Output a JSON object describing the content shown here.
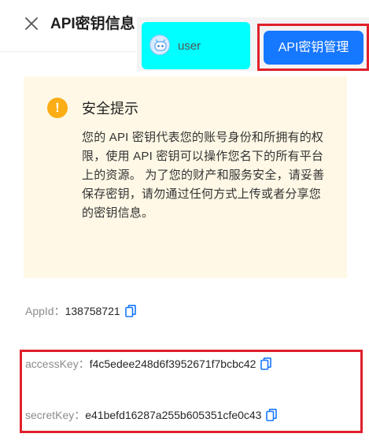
{
  "header": {
    "title": "API密钥信息"
  },
  "user": {
    "name": "user"
  },
  "toolbar": {
    "manage_label": "API密钥管理"
  },
  "notice": {
    "title": "安全提示",
    "body": "您的 API 密钥代表您的账号身份和所拥有的权限，使用 API 密钥可以操作您名下的所有平台上的资源。 为了您的财产和服务安全，请妥善保存密钥，请勿通过任何方式上传或者分享您的密钥信息。"
  },
  "credentials": {
    "appid_label": "AppId：",
    "appid_value": "138758721",
    "access_label": "accessKey：",
    "access_value": "f4c5edee248d6f3952671f7bcbc42",
    "secret_label": "secretKey：",
    "secret_value": "e41befd16287a255b605351cfe0c43"
  },
  "colors": {
    "primary": "#1677ff",
    "highlight_border": "#e0202b",
    "notice_bg": "#fff8e6",
    "warning": "#faad14",
    "user_chip_bg": "#00ffff"
  }
}
